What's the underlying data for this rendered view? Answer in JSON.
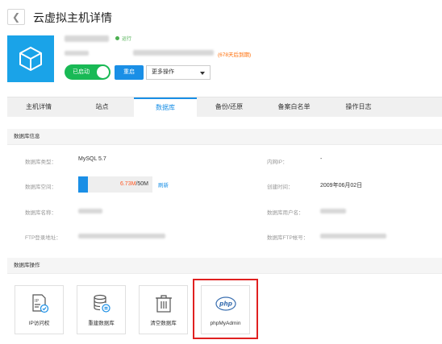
{
  "header": {
    "back_icon": "chevron-left-icon",
    "title": "云虚拟主机详情"
  },
  "host": {
    "icon": "cube-icon",
    "status": "运行",
    "expiry": "(678天后到期)",
    "toggle_label": "已启动",
    "restart_label": "重启",
    "more_label": "更多操作"
  },
  "tabs": [
    {
      "label": "主机详情"
    },
    {
      "label": "站点"
    },
    {
      "label": "数据库",
      "active": true
    },
    {
      "label": "备份/还原"
    },
    {
      "label": "备案白名单"
    },
    {
      "label": "操作日志"
    }
  ],
  "db_info": {
    "section_title": "数据库信息",
    "type_label": "数据库类型：",
    "type_value": "MySQL 5.7",
    "intranet_ip_label": "内网IP：",
    "intranet_ip_value": "-",
    "space_label": "数据库空间：",
    "space_used": "6.73M",
    "space_total": "/50M",
    "space_used_fraction": 0.13,
    "refresh_label": "刷新",
    "created_label": "创建时间：",
    "created_value": "2009年06月02日",
    "name_label": "数据库名称：",
    "user_label": "数据库用户名：",
    "ftp_label": "FTP登录地址：",
    "ftp_account_label": "数据库FTP帐号："
  },
  "db_ops": {
    "section_title": "数据库操作",
    "items": [
      {
        "label": "IP访问权",
        "icon": "ip-access-icon"
      },
      {
        "label": "重建数据库",
        "icon": "database-rebuild-icon"
      },
      {
        "label": "清空数据库",
        "icon": "trash-icon"
      },
      {
        "label": "phpMyAdmin",
        "icon": "php-icon",
        "icon_text": "php"
      }
    ]
  },
  "colors": {
    "accent": "#1a8fe6",
    "success": "#19b955",
    "warning": "#ff6a00",
    "highlight": "#e02020"
  }
}
